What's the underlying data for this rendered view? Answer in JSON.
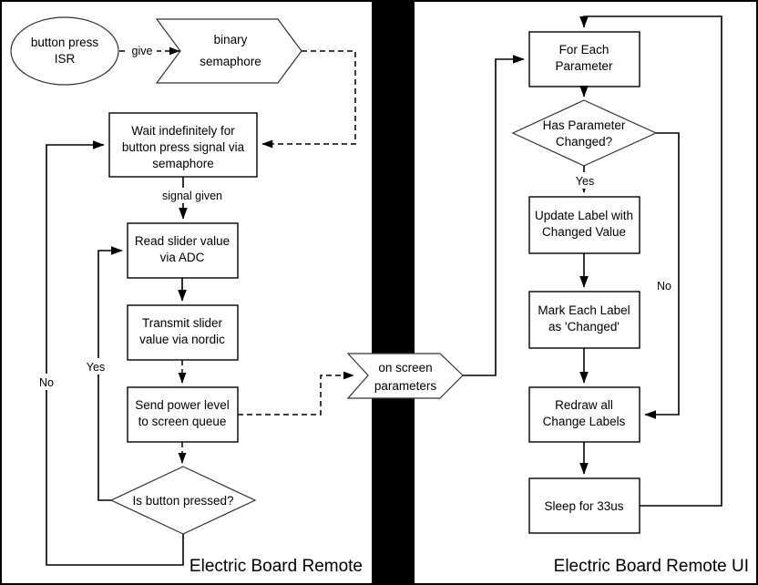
{
  "diagram": {
    "title_left": "Electric Board Remote",
    "title_right": "Electric Board Remote UI"
  },
  "left_panel": {
    "nodes": {
      "isr": "button press\nISR",
      "isr_line1": "button press",
      "isr_line2": "ISR",
      "semaphore_line1": "binary",
      "semaphore_line2": "semaphore",
      "wait_line1": "Wait indefinitely for",
      "wait_line2": "button press signal via",
      "wait_line3": "semaphore",
      "read_line1": "Read slider value",
      "read_line2": "via ADC",
      "transmit_line1": "Transmit slider",
      "transmit_line2": "value via nordic",
      "send_line1": "Send power level",
      "send_line2": "to screen queue",
      "decision": "Is button pressed?"
    },
    "edge_labels": {
      "give": "give",
      "signal_given": "signal given",
      "yes": "Yes",
      "no": "No"
    }
  },
  "middle": {
    "queue_line1": "on screen",
    "queue_line2": "parameters"
  },
  "right_panel": {
    "nodes": {
      "for_each_line1": "For Each",
      "for_each_line2": "Parameter",
      "decision_line1": "Has Parameter",
      "decision_line2": "Changed?",
      "update_line1": "Update Label with",
      "update_line2": "Changed Value",
      "mark_line1": "Mark Each Label",
      "mark_line2": "as 'Changed'",
      "redraw_line1": "Redraw all",
      "redraw_line2": "Change Labels",
      "sleep": "Sleep for 33us"
    },
    "edge_labels": {
      "yes": "Yes",
      "no": "No"
    }
  },
  "colors": {
    "stroke": "#000000",
    "fill": "#ffffff",
    "divider": "#000000"
  }
}
